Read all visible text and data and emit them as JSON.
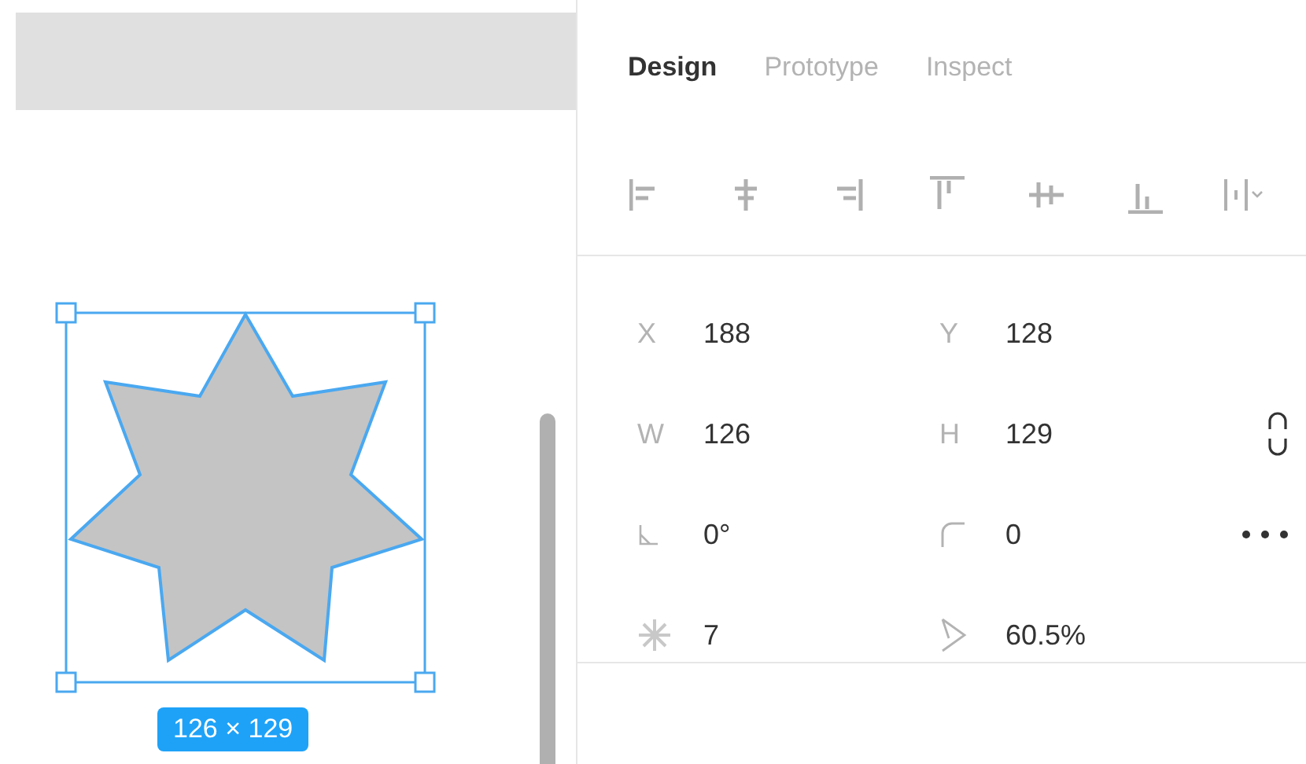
{
  "tabs": [
    {
      "label": "Design",
      "selected": true
    },
    {
      "label": "Prototype",
      "selected": false
    },
    {
      "label": "Inspect",
      "selected": false
    }
  ],
  "properties": [
    {
      "kind": "letter",
      "label": "X",
      "value": "188"
    },
    {
      "kind": "letter",
      "label": "Y",
      "value": "128"
    },
    {
      "kind": "letter",
      "label": "W",
      "value": "126"
    },
    {
      "kind": "letter",
      "label": "H",
      "value": "129"
    },
    {
      "kind": "rotation",
      "value": "0°"
    },
    {
      "kind": "radius",
      "value": "0"
    },
    {
      "kind": "points",
      "value": "7"
    },
    {
      "kind": "ratio",
      "value": "60.5%"
    }
  ],
  "size_badge": "126 × 129"
}
